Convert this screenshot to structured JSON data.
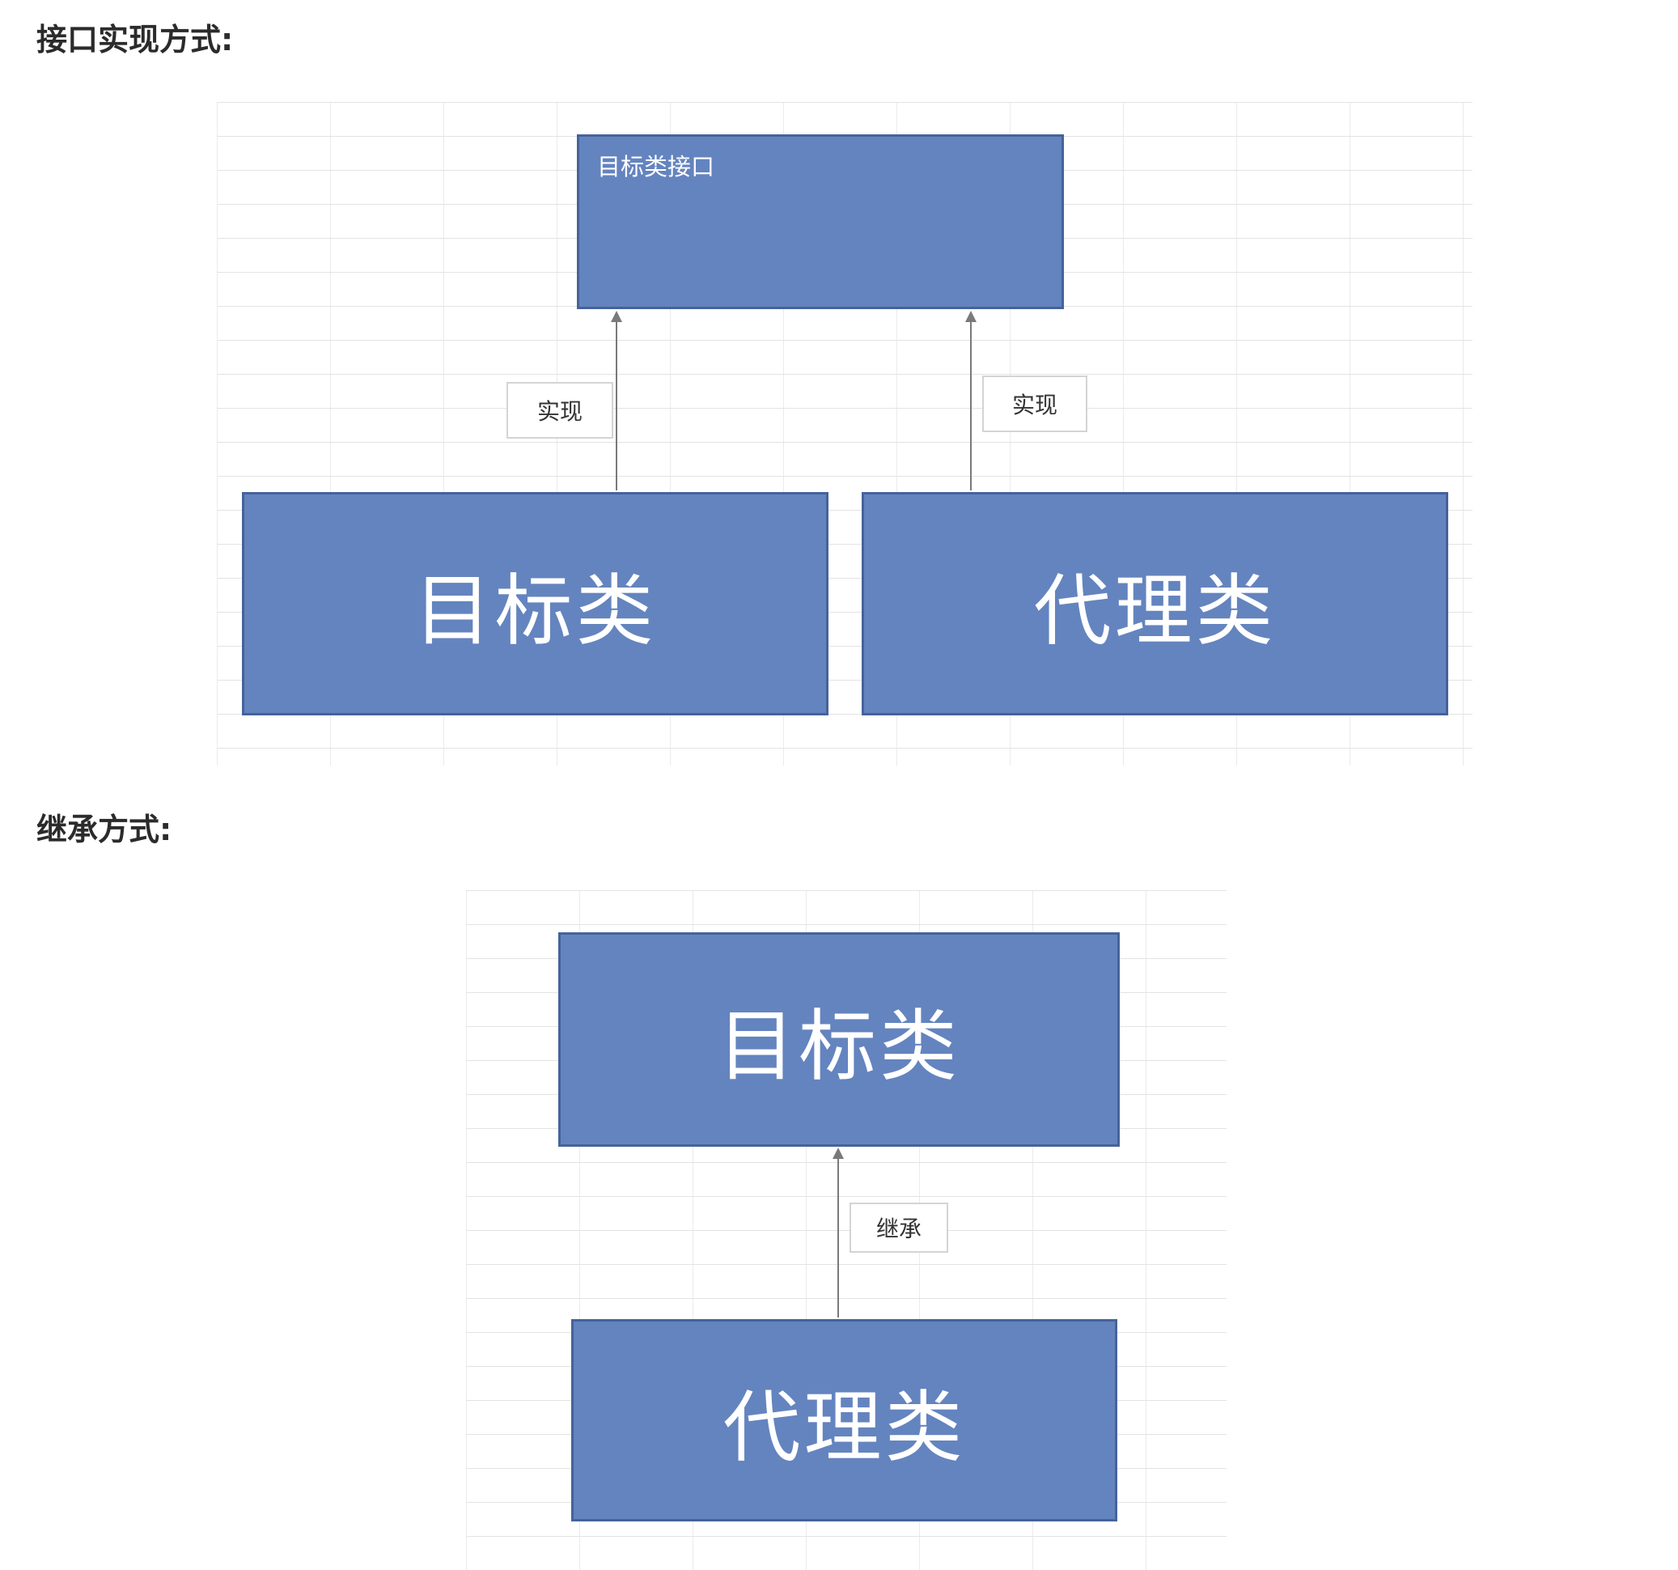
{
  "sections": {
    "interface": {
      "heading": "接口实现方式:",
      "interface_box": "目标类接口",
      "target_box": "目标类",
      "proxy_box": "代理类",
      "left_arrow_label": "实现",
      "right_arrow_label": "实现"
    },
    "inheritance": {
      "heading": "继承方式:",
      "target_box": "目标类",
      "proxy_box": "代理类",
      "arrow_label": "继承"
    }
  },
  "colors": {
    "box_fill": "#6484bf",
    "box_border": "#45639a",
    "connector": "#7a7a7a"
  }
}
